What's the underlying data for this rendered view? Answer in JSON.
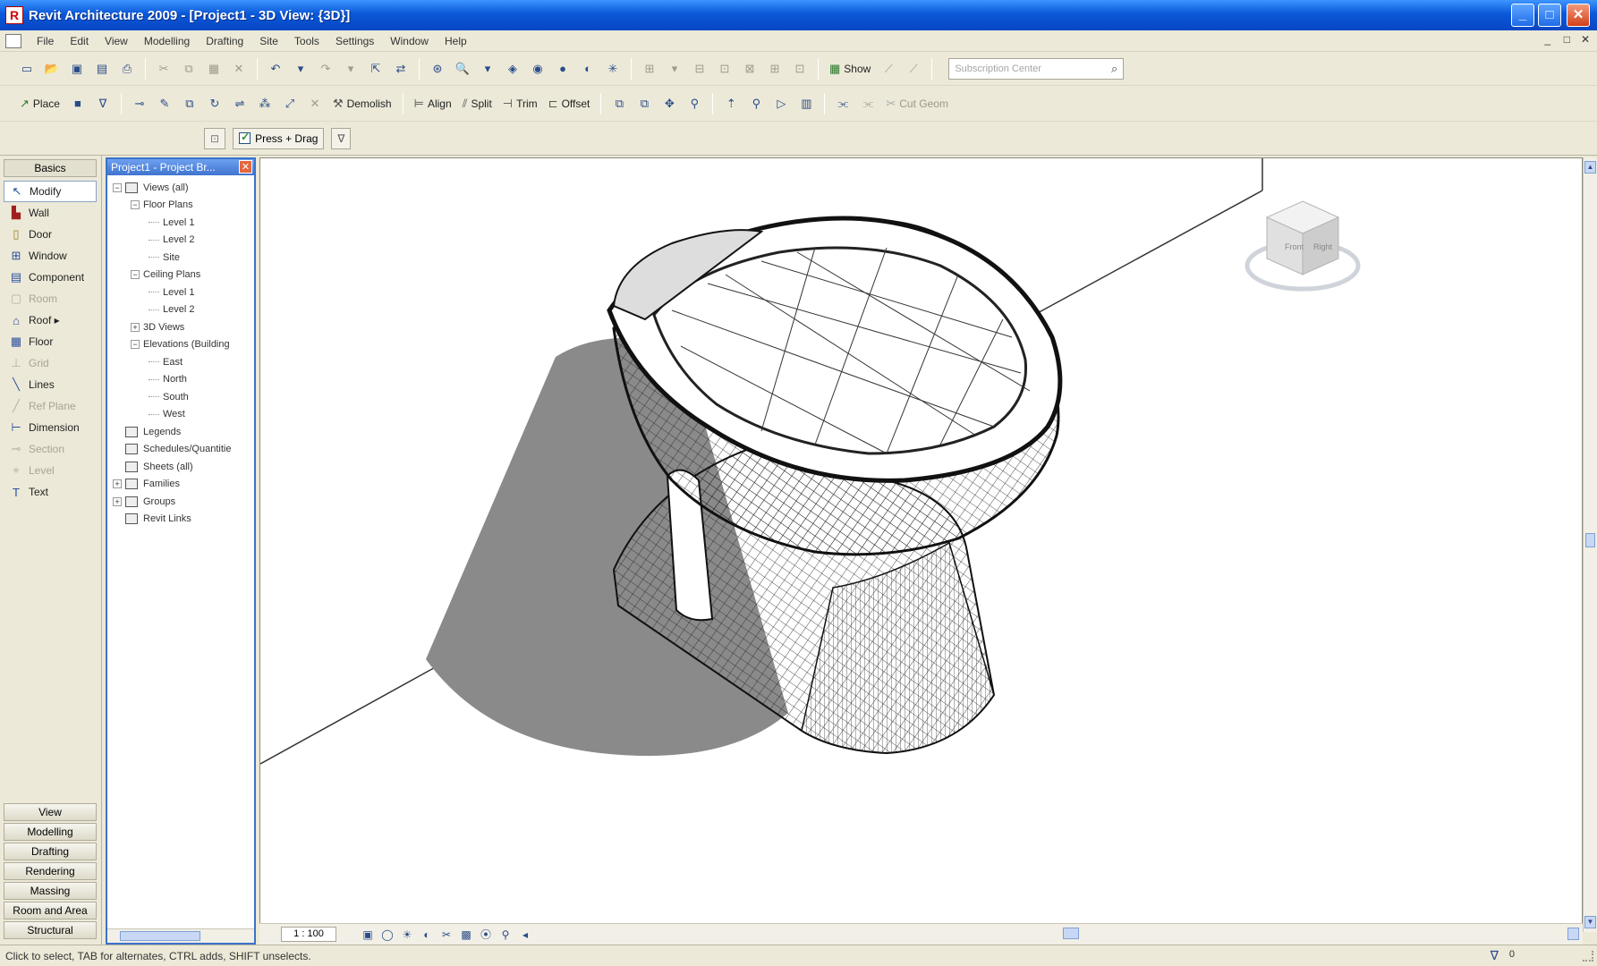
{
  "window": {
    "title": "Revit Architecture 2009 - [Project1 - 3D View: {3D}]",
    "minimize": "_",
    "maximize": "□",
    "close": "✕"
  },
  "menu": {
    "items": [
      "File",
      "Edit",
      "View",
      "Modelling",
      "Drafting",
      "Site",
      "Tools",
      "Settings",
      "Window",
      "Help"
    ],
    "mdi_min": "_",
    "mdi_restore": "□",
    "mdi_close": "✕"
  },
  "toolbar": {
    "search_placeholder": "Subscription Center",
    "show_label": "Show"
  },
  "edit_toolbar": {
    "place_label": "Place",
    "demolish_label": "Demolish",
    "align_label": "Align",
    "split_label": "Split",
    "trim_label": "Trim",
    "offset_label": "Offset",
    "join_label": "Cut Geom"
  },
  "options_bar": {
    "press_drag_label": "Press + Drag"
  },
  "design_bar": {
    "header": "Basics",
    "items": [
      {
        "label": "Modify",
        "icon": "arrow-cursor-icon",
        "state": "selected"
      },
      {
        "label": "Wall",
        "icon": "wall-icon",
        "state": "enabled"
      },
      {
        "label": "Door",
        "icon": "door-icon",
        "state": "enabled"
      },
      {
        "label": "Window",
        "icon": "window-icon",
        "state": "enabled"
      },
      {
        "label": "Component",
        "icon": "component-icon",
        "state": "enabled"
      },
      {
        "label": "Room",
        "icon": "room-icon",
        "state": "disabled"
      },
      {
        "label": "Roof ▸",
        "icon": "roof-icon",
        "state": "enabled"
      },
      {
        "label": "Floor",
        "icon": "floor-icon",
        "state": "enabled"
      },
      {
        "label": "Grid",
        "icon": "grid-icon",
        "state": "disabled"
      },
      {
        "label": "Lines",
        "icon": "lines-icon",
        "state": "enabled"
      },
      {
        "label": "Ref Plane",
        "icon": "ref-plane-icon",
        "state": "disabled"
      },
      {
        "label": "Dimension",
        "icon": "dimension-icon",
        "state": "enabled"
      },
      {
        "label": "Section",
        "icon": "section-icon",
        "state": "disabled"
      },
      {
        "label": "Level",
        "icon": "level-icon",
        "state": "disabled"
      },
      {
        "label": "Text",
        "icon": "text-icon",
        "state": "enabled"
      }
    ],
    "tabs": [
      "View",
      "Modelling",
      "Drafting",
      "Rendering",
      "Massing",
      "Room and Area",
      "Structural"
    ]
  },
  "project_browser": {
    "title": "Project1 - Project Br...",
    "close": "✕",
    "tree": [
      {
        "label": "Views (all)",
        "depth": 0,
        "expander": "−",
        "icon": true
      },
      {
        "label": "Floor Plans",
        "depth": 1,
        "expander": "−",
        "icon": false
      },
      {
        "label": "Level 1",
        "depth": 2,
        "expander": "",
        "icon": false
      },
      {
        "label": "Level 2",
        "depth": 2,
        "expander": "",
        "icon": false
      },
      {
        "label": "Site",
        "depth": 2,
        "expander": "",
        "icon": false
      },
      {
        "label": "Ceiling Plans",
        "depth": 1,
        "expander": "−",
        "icon": false
      },
      {
        "label": "Level 1",
        "depth": 2,
        "expander": "",
        "icon": false
      },
      {
        "label": "Level 2",
        "depth": 2,
        "expander": "",
        "icon": false
      },
      {
        "label": "3D Views",
        "depth": 1,
        "expander": "+",
        "icon": false
      },
      {
        "label": "Elevations (Building",
        "depth": 1,
        "expander": "−",
        "icon": false
      },
      {
        "label": "East",
        "depth": 2,
        "expander": "",
        "icon": false
      },
      {
        "label": "North",
        "depth": 2,
        "expander": "",
        "icon": false
      },
      {
        "label": "South",
        "depth": 2,
        "expander": "",
        "icon": false
      },
      {
        "label": "West",
        "depth": 2,
        "expander": "",
        "icon": false
      },
      {
        "label": "Legends",
        "depth": 0,
        "expander": "",
        "icon": true
      },
      {
        "label": "Schedules/Quantitie",
        "depth": 0,
        "expander": "",
        "icon": true
      },
      {
        "label": "Sheets (all)",
        "depth": 0,
        "expander": "",
        "icon": true
      },
      {
        "label": "Families",
        "depth": 0,
        "expander": "+",
        "icon": true
      },
      {
        "label": "Groups",
        "depth": 0,
        "expander": "+",
        "icon": true
      },
      {
        "label": "Revit Links",
        "depth": 0,
        "expander": "",
        "icon": true
      }
    ]
  },
  "view": {
    "scale": "1 : 100",
    "viewcube_faces": [
      "Front",
      "Right"
    ]
  },
  "status": {
    "message": "Click to select, TAB for alternates, CTRL adds, SHIFT unselects.",
    "filter_count": "0"
  },
  "colors": {
    "shadow": "#8a8a8a",
    "title_bar": "#0a58d8",
    "chrome": "#ece9d8"
  }
}
